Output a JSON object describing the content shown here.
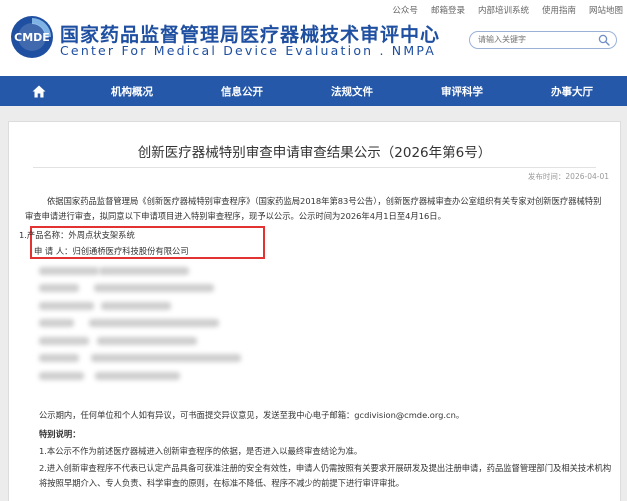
{
  "header": {
    "org_cn": "国家药品监督管理局医疗器械技术审评中心",
    "org_en": "Center For Medical Device Evaluation . NMPA",
    "logo_text": "CMDE",
    "top_links": [
      "公众号",
      "邮箱登录",
      "内部培训系统",
      "使用指南",
      "网站地图"
    ],
    "search_placeholder": "请输入关键字"
  },
  "nav": {
    "items": [
      "机构概况",
      "信息公开",
      "法规文件",
      "审评科学",
      "办事大厅"
    ]
  },
  "article": {
    "title": "创新医疗器械特别审查申请审查结果公示（2026年第6号）",
    "publish_date": "发布时间：2026-04-01",
    "intro": "依据国家药品监督管理局《创新医疗器械特别审查程序》（国家药监局2018年第83号公告），创新医疗器械审查办公室组织有关专家对创新医疗器械特别审查申请进行审查，拟同意以下申请项目进入特别审查程序，现予以公示。公示时间为2026年4月1日至4月16日。",
    "product_line": "1.产品名称：外周点状支架系统",
    "applicant_line": "申 请 人：归创通桥医疗科技股份有限公司",
    "notice": "公示期内，任何单位和个人如有异议，可书面提交异议意见，发送至我中心电子邮箱：gcdivision@cmde.org.cn。",
    "special_title": "特别说明：",
    "note1": "1.本公示不作为前述医疗器械进入创新审查程序的依据，是否进入以最终审查结论为准。",
    "note2": "2.进入创新审查程序不代表已认定产品具备可获准注册的安全有效性，申请人仍需按照有关要求开展研发及提出注册申请，药品监督管理部门及相关技术机构将按照早期介入、专人负责、科学审查的原则，在标准不降低、程序不减少的前提下进行审评审批。"
  },
  "colors": {
    "brand_blue": "#1f4fa0",
    "nav_bg": "#2558a8",
    "highlight_red": "#e23232"
  }
}
